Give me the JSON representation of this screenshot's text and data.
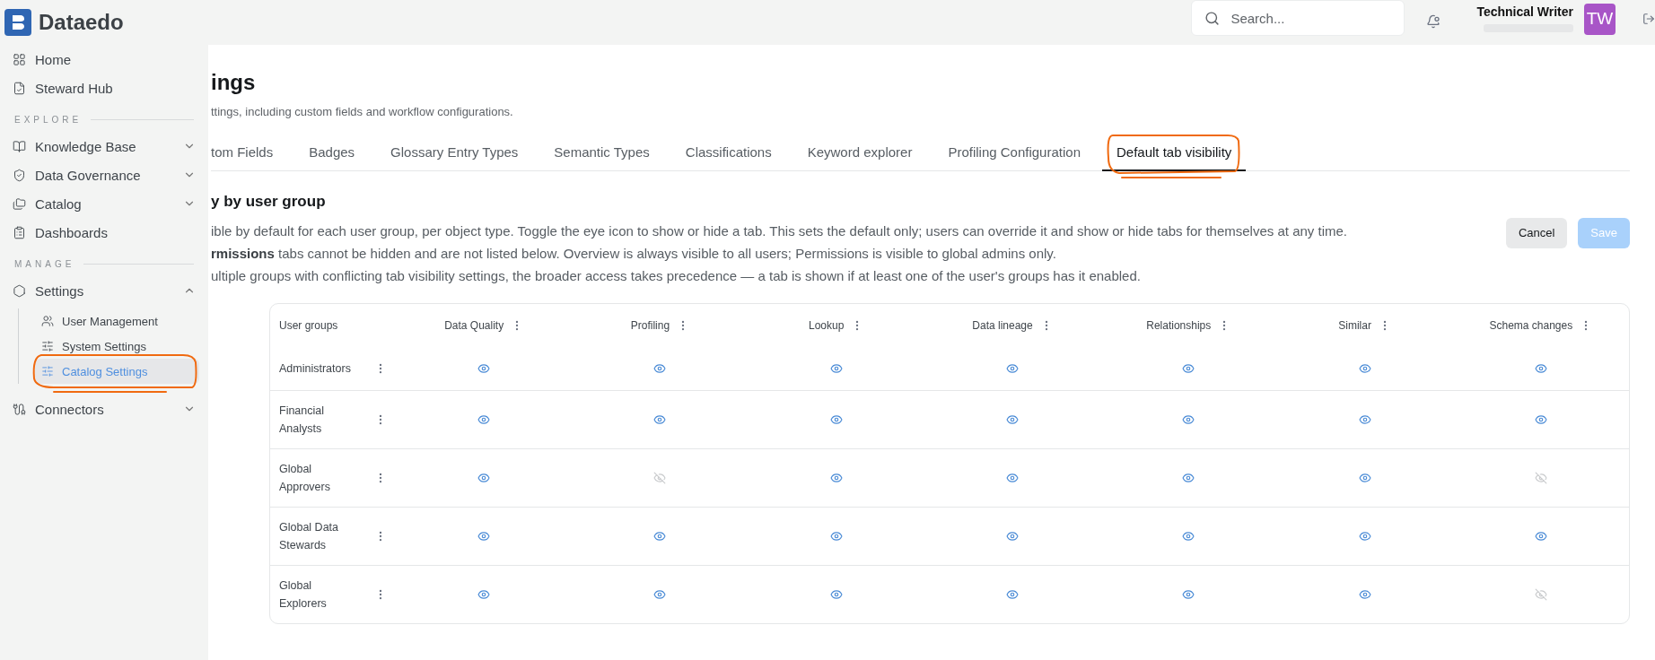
{
  "app": {
    "logo": "Dataedo"
  },
  "header": {
    "search": {
      "placeholder": "Search..."
    },
    "notification": {
      "unread": true
    },
    "user": {
      "name": "Technical Writer",
      "initials": "TW"
    }
  },
  "sidebar": {
    "sections": [
      {
        "items": [
          {
            "label": "Home"
          },
          {
            "label": "Steward Hub"
          }
        ]
      },
      {
        "heading": "EXPLORE",
        "items": [
          {
            "label": "Knowledge Base",
            "expanded": false
          },
          {
            "label": "Data Governance",
            "expanded": false
          },
          {
            "label": "Catalog",
            "expanded": false
          },
          {
            "label": "Dashboards"
          }
        ]
      },
      {
        "heading": "MANAGE",
        "items": [
          {
            "label": "Settings",
            "expanded": true,
            "children": [
              {
                "label": "User Management",
                "selected": false
              },
              {
                "label": "System Settings",
                "selected": false
              },
              {
                "label": "Catalog Settings",
                "selected": true
              }
            ]
          },
          {
            "label": "Connectors",
            "expanded": false
          }
        ]
      }
    ]
  },
  "page": {
    "title": "ings",
    "subtitle": "ttings, including custom fields and workflow configurations.",
    "tabs": [
      {
        "label": "tom Fields",
        "selected": false
      },
      {
        "label": "Badges",
        "selected": false
      },
      {
        "label": "Glossary Entry Types",
        "selected": false
      },
      {
        "label": "Semantic Types",
        "selected": false
      },
      {
        "label": "Classifications",
        "selected": false
      },
      {
        "label": "Keyword explorer",
        "selected": false
      },
      {
        "label": "Profiling Configuration",
        "selected": false
      },
      {
        "label": "Default tab visibility",
        "selected": true
      }
    ],
    "section_title": "y by user group",
    "description": [
      "ible by default for each user group, per object type. Toggle the eye icon to show or hide a tab. This sets the default only; users can override it and show or hide tabs for themselves at any time.",
      "**rmissions** tabs cannot be hidden and are not listed below. Overview is always visible to all users; Permissions is visible to global admins only.",
      "ultiple groups with conflicting tab visibility settings, the broader access takes precedence — a tab is shown if at least one of the user's groups has it enabled."
    ],
    "buttons": [
      {
        "label": "Cancel",
        "kind": "secondary",
        "disabled": false
      },
      {
        "label": "Save",
        "kind": "primary",
        "disabled": true
      }
    ],
    "table": {
      "columns": [
        "User groups",
        "Data Quality",
        "Profiling",
        "Lookup",
        "Data lineage",
        "Relationships",
        "Similar",
        "Schema changes"
      ],
      "rows": [
        {
          "group": "Administrators",
          "visible": [
            true,
            true,
            true,
            true,
            true,
            true,
            true
          ]
        },
        {
          "group": "Financial Analysts",
          "visible": [
            true,
            true,
            true,
            true,
            true,
            true,
            true
          ]
        },
        {
          "group": "Global Approvers",
          "visible": [
            true,
            false,
            true,
            true,
            true,
            true,
            false
          ]
        },
        {
          "group": "Global Data Stewards",
          "visible": [
            true,
            true,
            true,
            true,
            true,
            true,
            true
          ]
        },
        {
          "group": "Global Explorers",
          "visible": [
            true,
            true,
            true,
            true,
            true,
            true,
            false
          ]
        }
      ]
    }
  }
}
